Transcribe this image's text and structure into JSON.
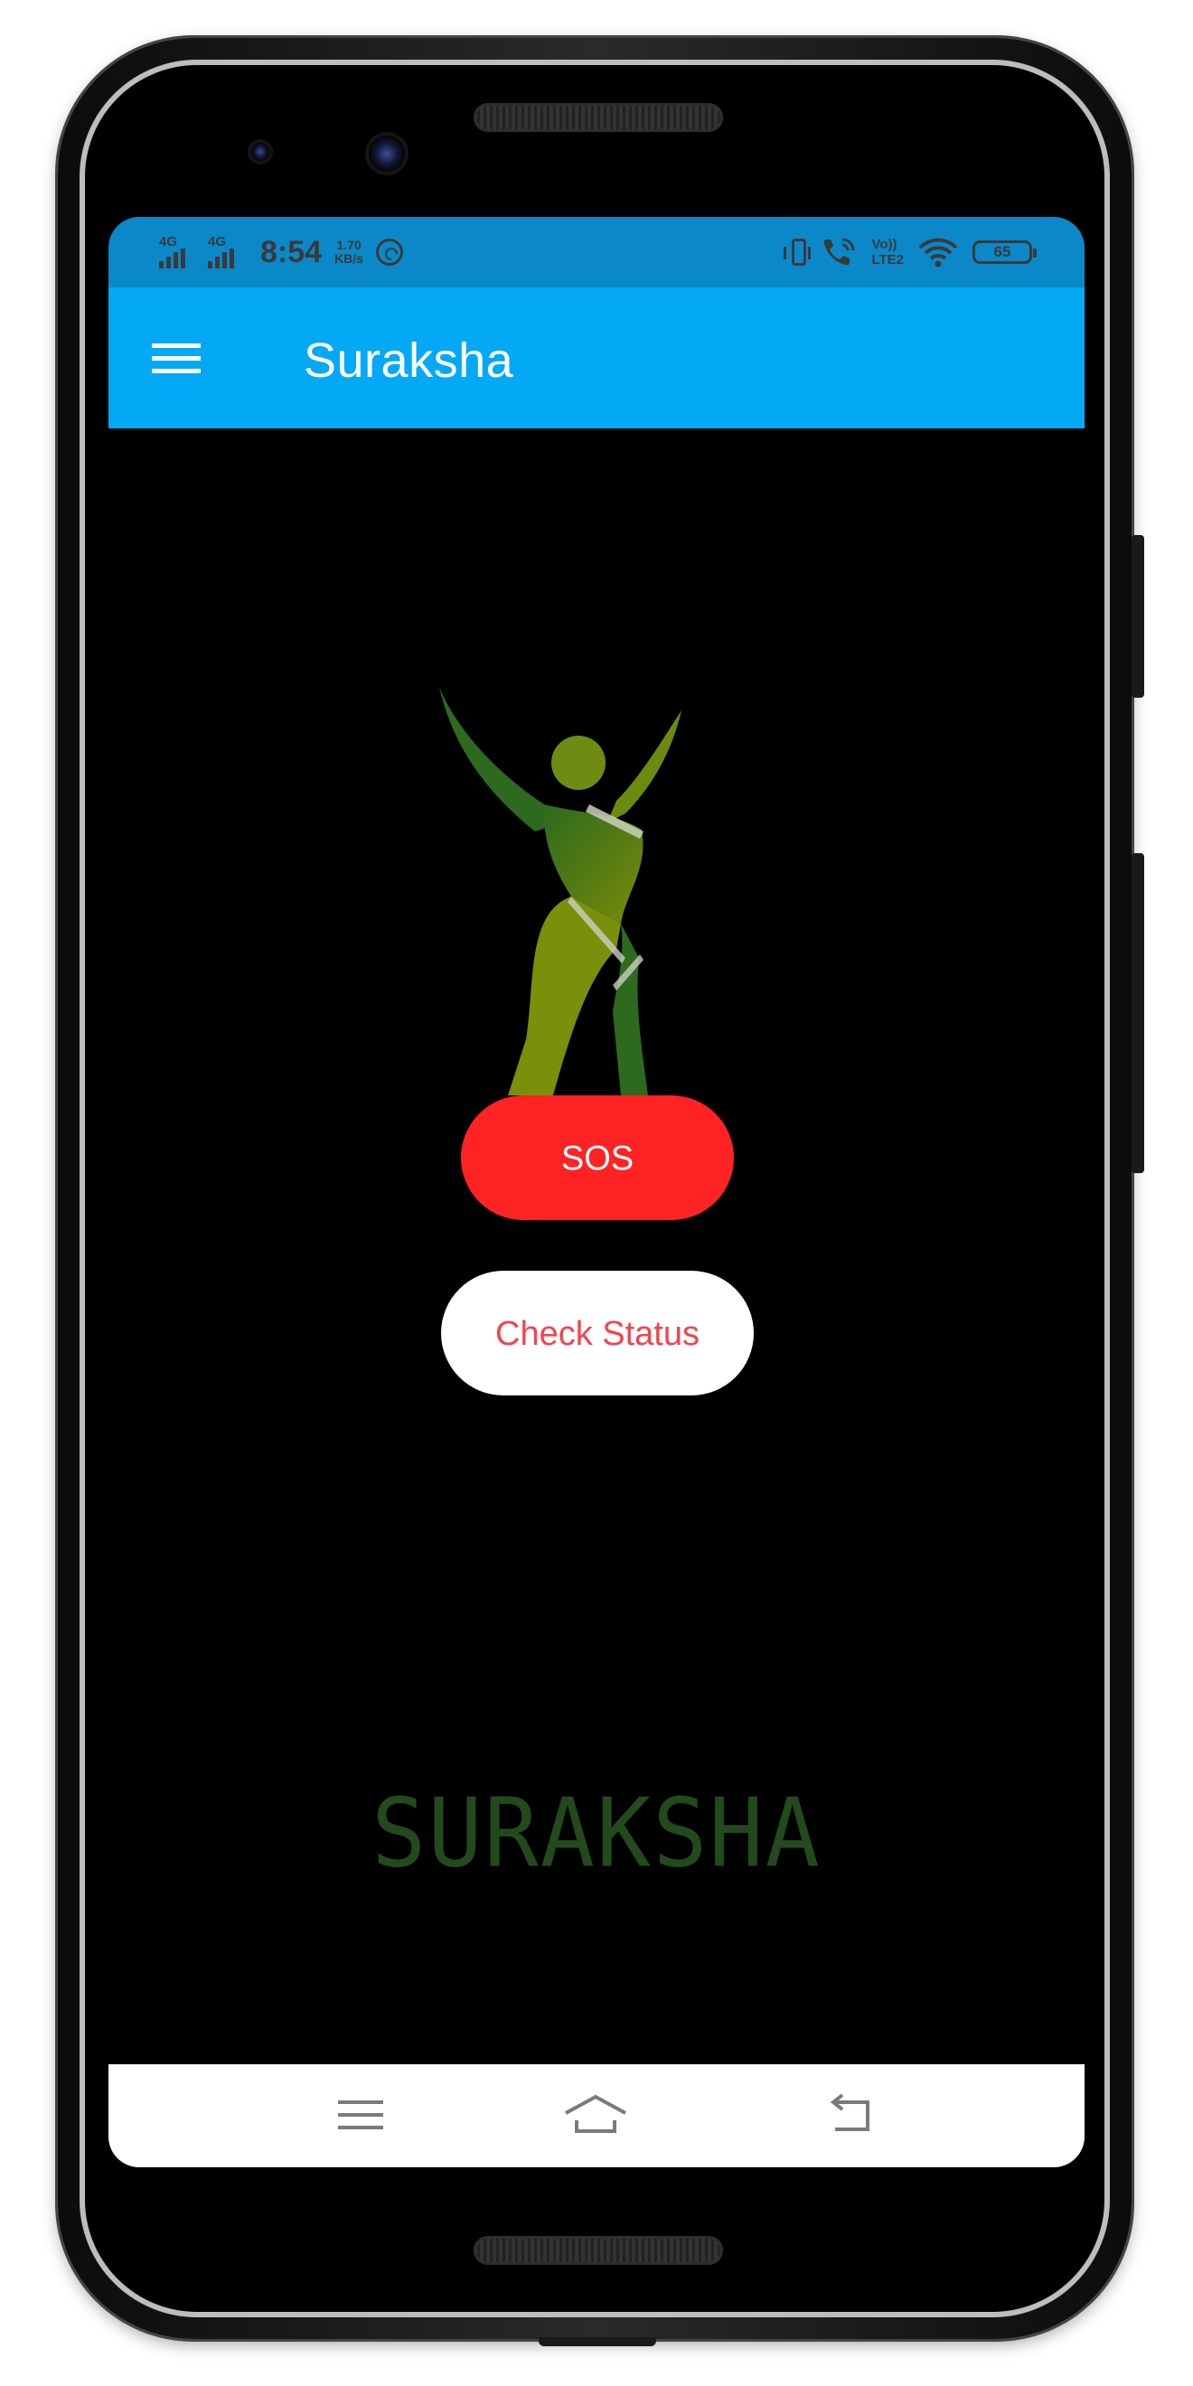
{
  "status_bar": {
    "signal_1_label": "4G",
    "signal_2_label": "4G",
    "time": "8:54",
    "net_speed_value": "1.70",
    "net_speed_unit": "KB/s",
    "volte_top": "Vo))",
    "volte_bottom": "LTE2",
    "battery_level": "65"
  },
  "app_bar": {
    "title": "Suraksha"
  },
  "main": {
    "sos_label": "SOS",
    "check_status_label": "Check Status",
    "brand_text": "SURAKSHA"
  },
  "icons": {
    "menu": "hamburger-menu-icon",
    "logo": "woman-figure-logo",
    "nav_menu": "recent-apps-icon",
    "nav_home": "home-icon",
    "nav_back": "back-icon"
  },
  "colors": {
    "status_bar": "#0b88c8",
    "app_bar": "#03a9f4",
    "sos_button": "#ff2323",
    "check_status_text": "#f2444e",
    "brand_text": "#234a1c",
    "logo_green": "#2d6a1e",
    "logo_olive": "#7a8f0a"
  }
}
